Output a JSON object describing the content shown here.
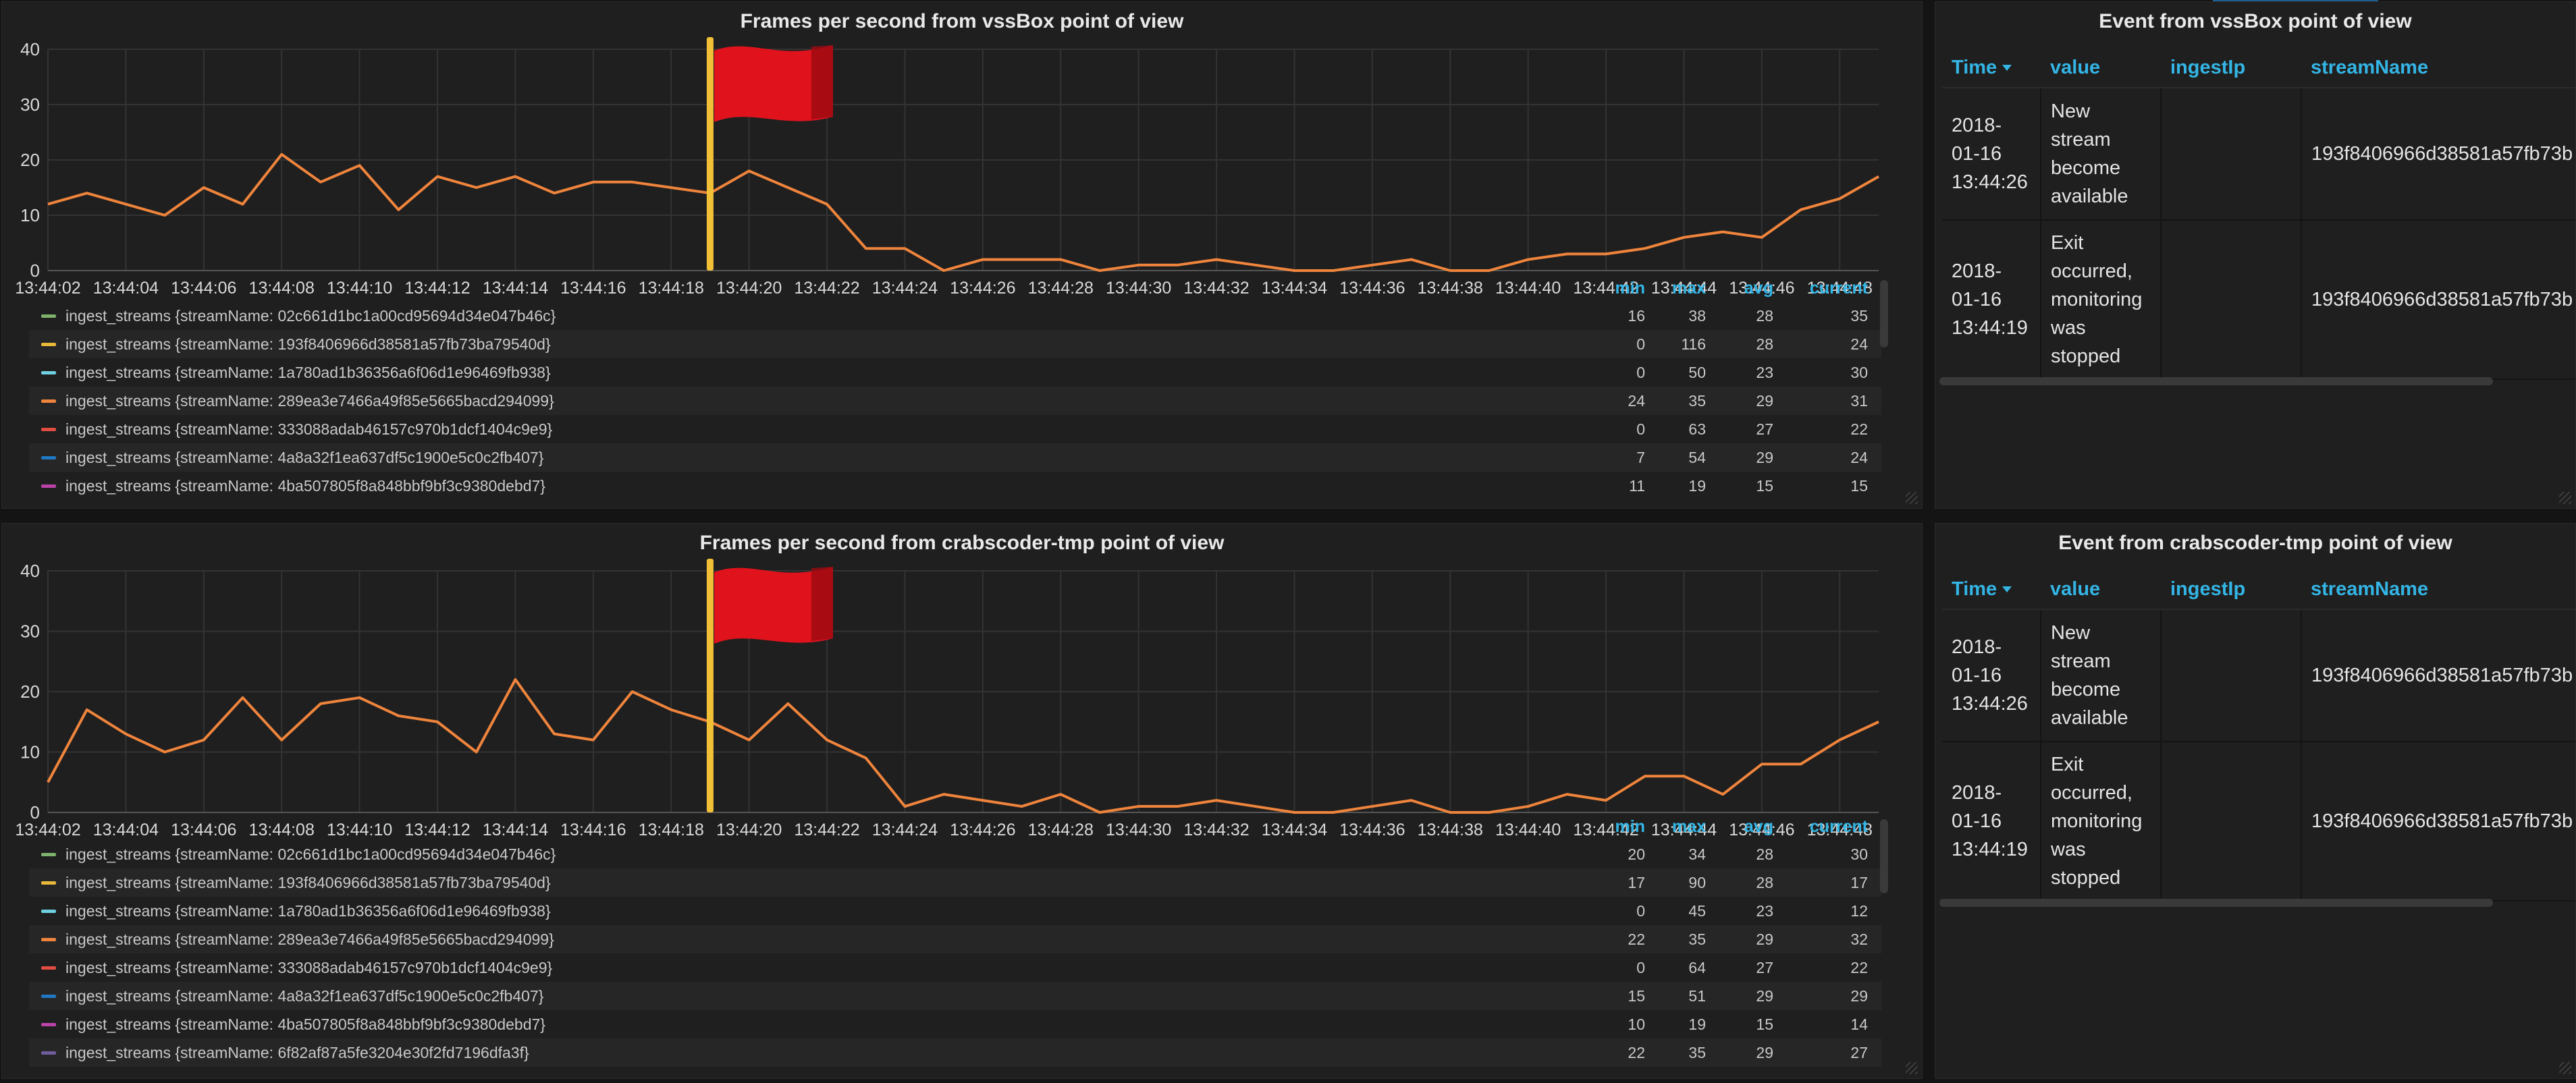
{
  "chart_data": [
    {
      "type": "line",
      "title": "Frames per second from vssBox point of view",
      "ylim": [
        0,
        40
      ],
      "yticks": [
        0,
        10,
        20,
        30,
        40
      ],
      "xticks": [
        "13:44:02",
        "13:44:04",
        "13:44:06",
        "13:44:08",
        "13:44:10",
        "13:44:12",
        "13:44:14",
        "13:44:16",
        "13:44:18",
        "13:44:20",
        "13:44:22",
        "13:44:24",
        "13:44:26",
        "13:44:28",
        "13:44:30",
        "13:44:32",
        "13:44:34",
        "13:44:36",
        "13:44:38",
        "13:44:40",
        "13:44:42",
        "13:44:44",
        "13:44:46",
        "13:44:48"
      ],
      "x": [
        "13:44:02",
        "13:44:03",
        "13:44:04",
        "13:44:05",
        "13:44:06",
        "13:44:07",
        "13:44:08",
        "13:44:09",
        "13:44:10",
        "13:44:11",
        "13:44:12",
        "13:44:13",
        "13:44:14",
        "13:44:15",
        "13:44:16",
        "13:44:17",
        "13:44:18",
        "13:44:19",
        "13:44:20",
        "13:44:21",
        "13:44:22",
        "13:44:23",
        "13:44:24",
        "13:44:25",
        "13:44:26",
        "13:44:27",
        "13:44:28",
        "13:44:29",
        "13:44:30",
        "13:44:31",
        "13:44:32",
        "13:44:33",
        "13:44:34",
        "13:44:35",
        "13:44:36",
        "13:44:37",
        "13:44:38",
        "13:44:39",
        "13:44:40",
        "13:44:41",
        "13:44:42",
        "13:44:43",
        "13:44:44",
        "13:44:45",
        "13:44:46",
        "13:44:47",
        "13:44:48",
        "13:44:49"
      ],
      "series": [
        {
          "color": "#ef843c",
          "values": [
            12,
            14,
            12,
            10,
            15,
            12,
            21,
            16,
            19,
            11,
            17,
            15,
            17,
            14,
            16,
            16,
            15,
            14,
            18,
            15,
            12,
            4,
            4,
            0,
            2,
            2,
            2,
            0,
            1,
            1,
            2,
            1,
            0,
            0,
            1,
            2,
            0,
            0,
            2,
            3,
            3,
            4,
            6,
            7,
            6,
            11,
            13,
            17
          ]
        }
      ],
      "annotation": {
        "x": "13:44:19"
      },
      "legend": {
        "headers": {
          "min": "min",
          "max": "max",
          "avg": "avg",
          "current": "current"
        },
        "rows": [
          {
            "name": "ingest_streams {streamName: 02c661d1bc1a00cd95694d34e047b46c}",
            "color": "#7eb26d",
            "min": "16",
            "max": "38",
            "avg": "28",
            "current": "35"
          },
          {
            "name": "ingest_streams {streamName: 193f8406966d38581a57fb73ba79540d}",
            "color": "#eab839",
            "min": "0",
            "max": "116",
            "avg": "28",
            "current": "24"
          },
          {
            "name": "ingest_streams {streamName: 1a780ad1b36356a6f06d1e96469fb938}",
            "color": "#6ed0e0",
            "min": "0",
            "max": "50",
            "avg": "23",
            "current": "30"
          },
          {
            "name": "ingest_streams {streamName: 289ea3e7466a49f85e5665bacd294099}",
            "color": "#ef843c",
            "min": "24",
            "max": "35",
            "avg": "29",
            "current": "31"
          },
          {
            "name": "ingest_streams {streamName: 333088adab46157c970b1dcf1404c9e9}",
            "color": "#e24d42",
            "min": "0",
            "max": "63",
            "avg": "27",
            "current": "22"
          },
          {
            "name": "ingest_streams {streamName: 4a8a32f1ea637df5c1900e5c0c2fb407}",
            "color": "#1f78c1",
            "min": "7",
            "max": "54",
            "avg": "29",
            "current": "24"
          },
          {
            "name": "ingest_streams {streamName: 4ba507805f8a848bbf9bf3c9380debd7}",
            "color": "#ba43a9",
            "min": "11",
            "max": "19",
            "avg": "15",
            "current": "15"
          }
        ]
      }
    },
    {
      "type": "line",
      "title": "Frames per second from crabscoder-tmp point of view",
      "ylim": [
        0,
        40
      ],
      "yticks": [
        0,
        10,
        20,
        30,
        40
      ],
      "xticks": [
        "13:44:02",
        "13:44:04",
        "13:44:06",
        "13:44:08",
        "13:44:10",
        "13:44:12",
        "13:44:14",
        "13:44:16",
        "13:44:18",
        "13:44:20",
        "13:44:22",
        "13:44:24",
        "13:44:26",
        "13:44:28",
        "13:44:30",
        "13:44:32",
        "13:44:34",
        "13:44:36",
        "13:44:38",
        "13:44:40",
        "13:44:42",
        "13:44:44",
        "13:44:46",
        "13:44:48"
      ],
      "x": [
        "13:44:02",
        "13:44:03",
        "13:44:04",
        "13:44:05",
        "13:44:06",
        "13:44:07",
        "13:44:08",
        "13:44:09",
        "13:44:10",
        "13:44:11",
        "13:44:12",
        "13:44:13",
        "13:44:14",
        "13:44:15",
        "13:44:16",
        "13:44:17",
        "13:44:18",
        "13:44:19",
        "13:44:20",
        "13:44:21",
        "13:44:22",
        "13:44:23",
        "13:44:24",
        "13:44:25",
        "13:44:26",
        "13:44:27",
        "13:44:28",
        "13:44:29",
        "13:44:30",
        "13:44:31",
        "13:44:32",
        "13:44:33",
        "13:44:34",
        "13:44:35",
        "13:44:36",
        "13:44:37",
        "13:44:38",
        "13:44:39",
        "13:44:40",
        "13:44:41",
        "13:44:42",
        "13:44:43",
        "13:44:44",
        "13:44:45",
        "13:44:46",
        "13:44:47",
        "13:44:48",
        "13:44:49"
      ],
      "series": [
        {
          "color": "#ef843c",
          "values": [
            5,
            17,
            13,
            10,
            12,
            19,
            12,
            18,
            19,
            16,
            15,
            10,
            22,
            13,
            12,
            20,
            17,
            15,
            12,
            18,
            12,
            9,
            1,
            3,
            2,
            1,
            3,
            0,
            1,
            1,
            2,
            1,
            0,
            0,
            1,
            2,
            0,
            0,
            1,
            3,
            2,
            6,
            6,
            3,
            8,
            8,
            12,
            15
          ]
        }
      ],
      "annotation": {
        "x": "13:44:19"
      },
      "legend": {
        "headers": {
          "min": "min",
          "max": "max",
          "avg": "avg",
          "current": "current"
        },
        "rows": [
          {
            "name": "ingest_streams {streamName: 02c661d1bc1a00cd95694d34e047b46c}",
            "color": "#7eb26d",
            "min": "20",
            "max": "34",
            "avg": "28",
            "current": "30"
          },
          {
            "name": "ingest_streams {streamName: 193f8406966d38581a57fb73ba79540d}",
            "color": "#eab839",
            "min": "17",
            "max": "90",
            "avg": "28",
            "current": "17"
          },
          {
            "name": "ingest_streams {streamName: 1a780ad1b36356a6f06d1e96469fb938}",
            "color": "#6ed0e0",
            "min": "0",
            "max": "45",
            "avg": "23",
            "current": "12"
          },
          {
            "name": "ingest_streams {streamName: 289ea3e7466a49f85e5665bacd294099}",
            "color": "#ef843c",
            "min": "22",
            "max": "35",
            "avg": "29",
            "current": "32"
          },
          {
            "name": "ingest_streams {streamName: 333088adab46157c970b1dcf1404c9e9}",
            "color": "#e24d42",
            "min": "0",
            "max": "64",
            "avg": "27",
            "current": "22"
          },
          {
            "name": "ingest_streams {streamName: 4a8a32f1ea637df5c1900e5c0c2fb407}",
            "color": "#1f78c1",
            "min": "15",
            "max": "51",
            "avg": "29",
            "current": "29"
          },
          {
            "name": "ingest_streams {streamName: 4ba507805f8a848bbf9bf3c9380debd7}",
            "color": "#ba43a9",
            "min": "10",
            "max": "19",
            "avg": "15",
            "current": "14"
          },
          {
            "name": "ingest_streams {streamName: 6f82af87a5fe3204e30f2fd7196dfa3f}",
            "color": "#705da0",
            "min": "22",
            "max": "35",
            "avg": "29",
            "current": "27"
          }
        ]
      }
    }
  ],
  "event_panels": [
    {
      "title": "Event from vssBox point of view",
      "columns": [
        "Time",
        "value",
        "ingestIp",
        "streamName"
      ],
      "rows": [
        {
          "time": [
            "2018-",
            "01-16",
            "13:44:26"
          ],
          "value": [
            "New",
            "stream",
            "become",
            "available"
          ],
          "ingestIp": "",
          "streamName": "193f8406966d38581a57fb73b"
        },
        {
          "time": [
            "2018-",
            "01-16",
            "13:44:19"
          ],
          "value": [
            "Exit",
            "occurred,",
            "monitoring",
            "was",
            "stopped"
          ],
          "ingestIp": "",
          "streamName": "193f8406966d38581a57fb73b"
        }
      ]
    },
    {
      "title": "Event from crabscoder-tmp point of view",
      "columns": [
        "Time",
        "value",
        "ingestIp",
        "streamName"
      ],
      "rows": [
        {
          "time": [
            "2018-",
            "01-16",
            "13:44:26"
          ],
          "value": [
            "New",
            "stream",
            "become",
            "available"
          ],
          "ingestIp": "",
          "streamName": "193f8406966d38581a57fb73b"
        },
        {
          "time": [
            "2018-",
            "01-16",
            "13:44:19"
          ],
          "value": [
            "Exit",
            "occurred,",
            "monitoring",
            "was",
            "stopped"
          ],
          "ingestIp": "",
          "streamName": "193f8406966d38581a57fb73b"
        }
      ]
    }
  ],
  "colors": {
    "background": "#141414",
    "panel": "#1f1f1f",
    "grid": "#333333",
    "accent": "#33b5e5",
    "annotation": "#f2c037",
    "flag": "#e0121c"
  }
}
